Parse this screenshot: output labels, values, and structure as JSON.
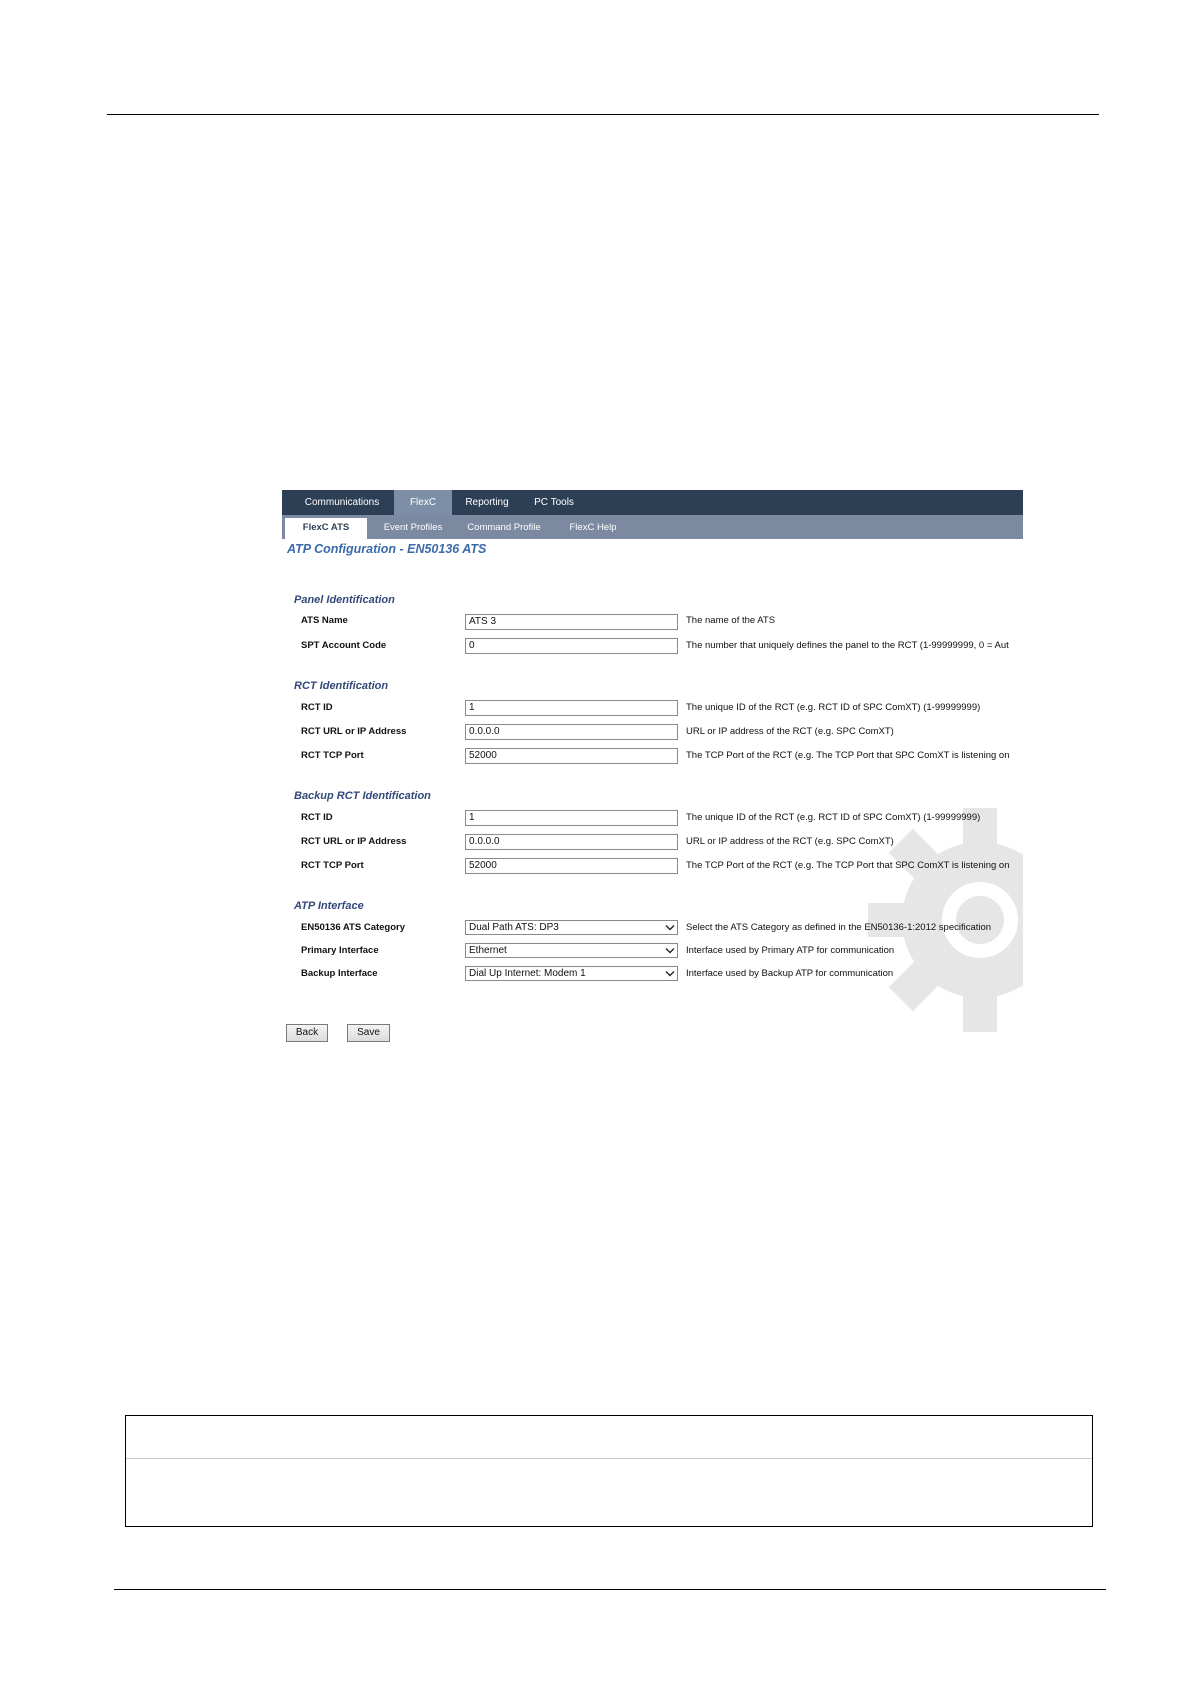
{
  "top_nav": {
    "tabs": [
      {
        "label": "Communications",
        "active": false
      },
      {
        "label": "FlexC",
        "active": true
      },
      {
        "label": "Reporting",
        "active": false
      },
      {
        "label": "PC Tools",
        "active": false
      }
    ]
  },
  "sub_nav": {
    "tabs": [
      {
        "label": "FlexC ATS",
        "active": true
      },
      {
        "label": "Event Profiles",
        "active": false
      },
      {
        "label": "Command Profile",
        "active": false
      },
      {
        "label": "FlexC Help",
        "active": false
      }
    ]
  },
  "page_title": "ATP Configuration - EN50136 ATS",
  "sections": {
    "panel_identification": {
      "title": "Panel Identification",
      "fields": [
        {
          "label": "ATS Name",
          "value": "ATS 3",
          "help": "The name of the ATS"
        },
        {
          "label": "SPT Account Code",
          "value": "0",
          "help": "The number that uniquely defines the panel to the RCT (1-99999999, 0 = Aut"
        }
      ]
    },
    "rct_identification": {
      "title": "RCT Identification",
      "fields": [
        {
          "label": "RCT ID",
          "value": "1",
          "help": "The unique ID of the RCT (e.g. RCT ID of SPC ComXT) (1-99999999)"
        },
        {
          "label": "RCT URL or IP Address",
          "value": "0.0.0.0",
          "help": "URL or IP address of the RCT (e.g. SPC ComXT)"
        },
        {
          "label": "RCT TCP Port",
          "value": "52000",
          "help": "The TCP Port of the RCT (e.g. The TCP Port that SPC ComXT is listening on"
        }
      ]
    },
    "backup_rct_identification": {
      "title": "Backup RCT Identification",
      "fields": [
        {
          "label": "RCT ID",
          "value": "1",
          "help": "The unique ID of the RCT (e.g. RCT ID of SPC ComXT) (1-99999999)"
        },
        {
          "label": "RCT URL or IP Address",
          "value": "0.0.0.0",
          "help": "URL or IP address of the RCT (e.g. SPC ComXT)"
        },
        {
          "label": "RCT TCP Port",
          "value": "52000",
          "help": "The TCP Port of the RCT (e.g. The TCP Port that SPC ComXT is listening on"
        }
      ]
    },
    "atp_interface": {
      "title": "ATP Interface",
      "fields": [
        {
          "label": "EN50136 ATS Category",
          "value": "Dual Path ATS: DP3",
          "help": "Select the ATS Category as defined in the EN50136-1:2012 specification"
        },
        {
          "label": "Primary Interface",
          "value": "Ethernet",
          "help": "Interface used by Primary ATP for communication"
        },
        {
          "label": "Backup Interface",
          "value": "Dial Up Internet: Modem 1",
          "help": "Interface used by Backup ATP for communication"
        }
      ]
    }
  },
  "buttons": {
    "back": "Back",
    "save": "Save"
  },
  "colors": {
    "top_nav_bg": "#2d3f55",
    "sub_nav_bg": "#7b8aa1",
    "title_blue": "#3b6aa8",
    "section_blue": "#33497a"
  }
}
